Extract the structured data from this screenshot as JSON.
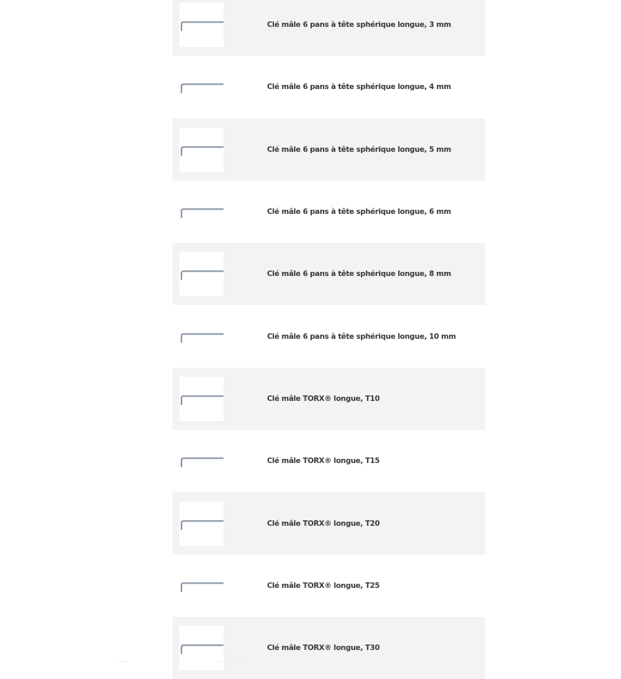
{
  "products": [
    {
      "name": "Clé mâle 6 pans à tête sphérique longue, 3 mm",
      "icon": "hex-key-icon"
    },
    {
      "name": "Clé mâle 6 pans à tête sphérique longue, 4 mm",
      "icon": "hex-key-icon"
    },
    {
      "name": "Clé mâle 6 pans à tête sphérique longue, 5 mm",
      "icon": "hex-key-icon"
    },
    {
      "name": "Clé mâle 6 pans à tête sphérique longue, 6 mm",
      "icon": "hex-key-icon"
    },
    {
      "name": "Clé mâle 6 pans à tête sphérique longue, 8 mm",
      "icon": "hex-key-icon"
    },
    {
      "name": "Clé mâle 6 pans à tête sphérique longue, 10 mm",
      "icon": "hex-key-icon"
    },
    {
      "name": "Clé mâle TORX® longue, T10",
      "icon": "torx-key-icon"
    },
    {
      "name": "Clé mâle TORX® longue, T15",
      "icon": "torx-key-icon"
    },
    {
      "name": "Clé mâle TORX® longue, T20",
      "icon": "torx-key-icon"
    },
    {
      "name": "Clé mâle TORX® longue, T25",
      "icon": "torx-key-icon"
    },
    {
      "name": "Clé mâle TORX® longue, T30",
      "icon": "torx-key-icon"
    }
  ],
  "colors": {
    "row_shaded": "#f3f3f3",
    "row_plain": "#ffffff",
    "text": "#3a3a3a",
    "key_metal": "#8b96a3"
  }
}
